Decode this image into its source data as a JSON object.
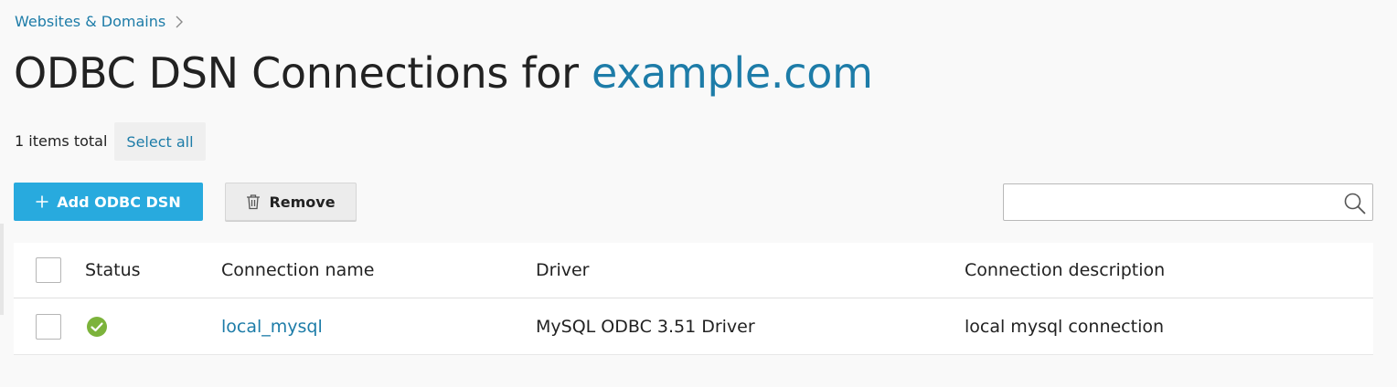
{
  "breadcrumb": {
    "items": [
      "Websites & Domains"
    ]
  },
  "page": {
    "title_prefix": "ODBC DSN Connections for ",
    "title_domain": "example.com"
  },
  "list": {
    "items_total": "1 items total",
    "select_all": "Select all"
  },
  "toolbar": {
    "add_label": "Add ODBC DSN",
    "remove_label": "Remove"
  },
  "search": {
    "value": "",
    "placeholder": ""
  },
  "table": {
    "headers": {
      "status": "Status",
      "connection_name": "Connection name",
      "driver": "Driver",
      "connection_description": "Connection description"
    },
    "rows": [
      {
        "status": "ok",
        "connection_name": "local_mysql",
        "driver": "MySQL ODBC 3.51 Driver",
        "connection_description": "local mysql connection"
      }
    ]
  },
  "icons": {
    "breadcrumb_separator": "chevron-right-icon",
    "add": "plus-icon",
    "remove": "trash-icon",
    "search": "search-icon",
    "status_ok": "check-circle-icon"
  },
  "colors": {
    "link": "#1d7ca8",
    "primary_button": "#28aade",
    "status_ok": "#7cb33b",
    "background": "#f9f9f9"
  }
}
